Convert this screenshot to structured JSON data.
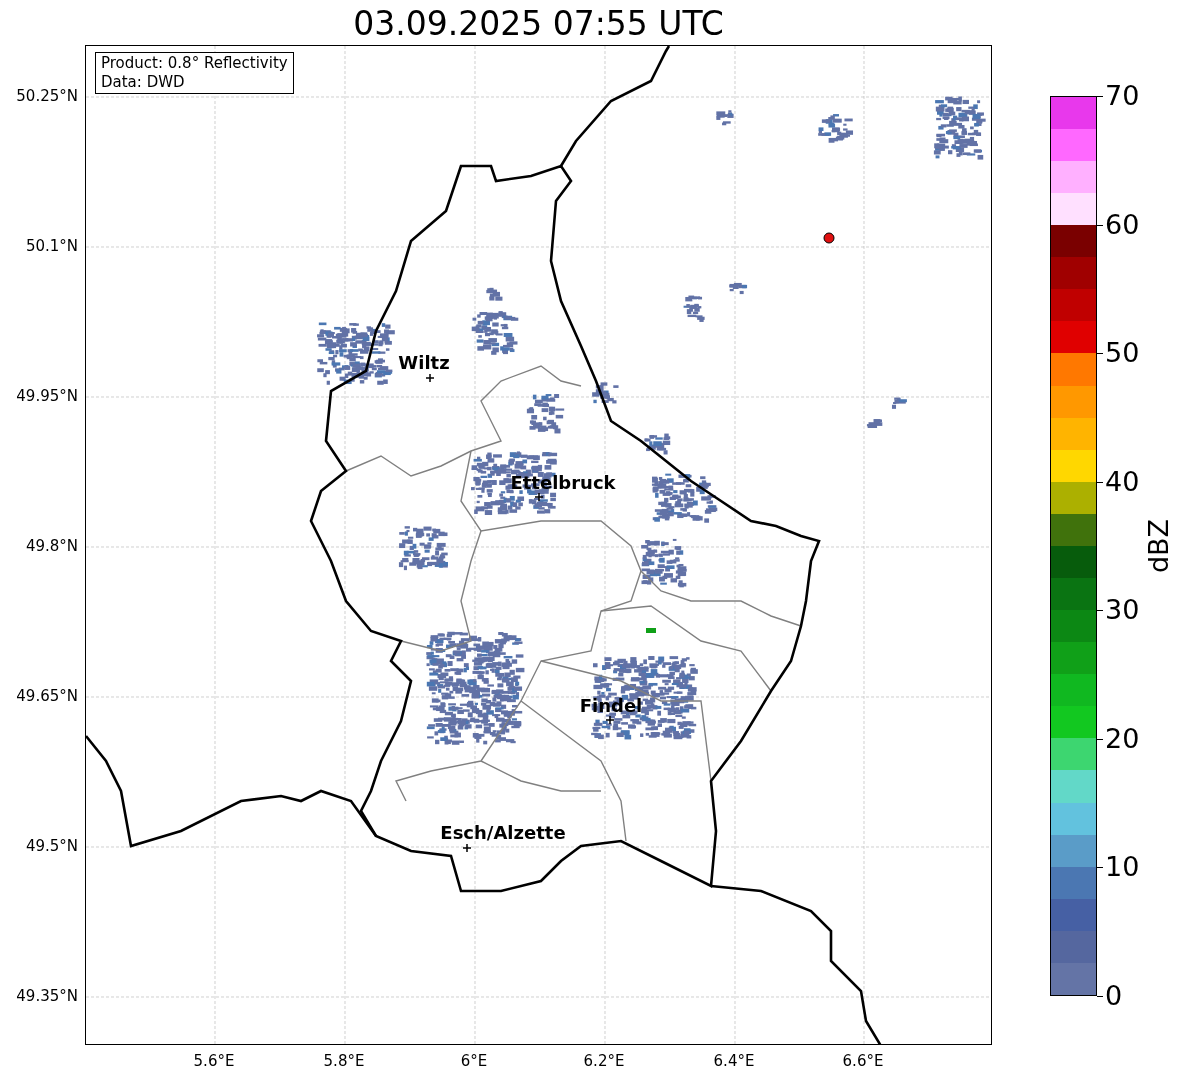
{
  "title": "03.09.2025 07:55 UTC",
  "info_box": [
    "Product: 0.8° Reflectivity",
    "Data: DWD"
  ],
  "map": {
    "x_ticks": [
      "5.6°E",
      "5.8°E",
      "6°E",
      "6.2°E",
      "6.4°E",
      "6.6°E"
    ],
    "y_ticks": [
      "50.25°N",
      "50.1°N",
      "49.95°N",
      "49.8°N",
      "49.65°N",
      "49.5°N",
      "49.35°N"
    ],
    "cities": [
      {
        "name": "Wiltz"
      },
      {
        "name": "Ettelbruck"
      },
      {
        "name": "Findel"
      },
      {
        "name": "Esch/Alzette"
      }
    ]
  },
  "colorbar": {
    "label": "dBZ",
    "ticks": [
      "70",
      "60",
      "50",
      "40",
      "30",
      "20",
      "10",
      "0"
    ],
    "bins": [
      {
        "color": "#6474a6"
      },
      {
        "color": "#55679f"
      },
      {
        "color": "#4660a4"
      },
      {
        "color": "#4b77b2"
      },
      {
        "color": "#5a9cc8"
      },
      {
        "color": "#62c2de"
      },
      {
        "color": "#62d8c8"
      },
      {
        "color": "#3dd670"
      },
      {
        "color": "#12c820"
      },
      {
        "color": "#10b820"
      },
      {
        "color": "#10a018"
      },
      {
        "color": "#0c8814"
      },
      {
        "color": "#0a7412"
      },
      {
        "color": "#075c0c"
      },
      {
        "color": "#40720c"
      },
      {
        "color": "#acb000"
      },
      {
        "color": "#ffd700"
      },
      {
        "color": "#ffb400"
      },
      {
        "color": "#ff9800"
      },
      {
        "color": "#ff7800"
      },
      {
        "color": "#e00000"
      },
      {
        "color": "#c00000"
      },
      {
        "color": "#a00000"
      },
      {
        "color": "#7a0000"
      },
      {
        "color": "#ffe0ff"
      },
      {
        "color": "#ffb0ff"
      },
      {
        "color": "#ff68ff"
      },
      {
        "color": "#e838ec"
      }
    ]
  }
}
